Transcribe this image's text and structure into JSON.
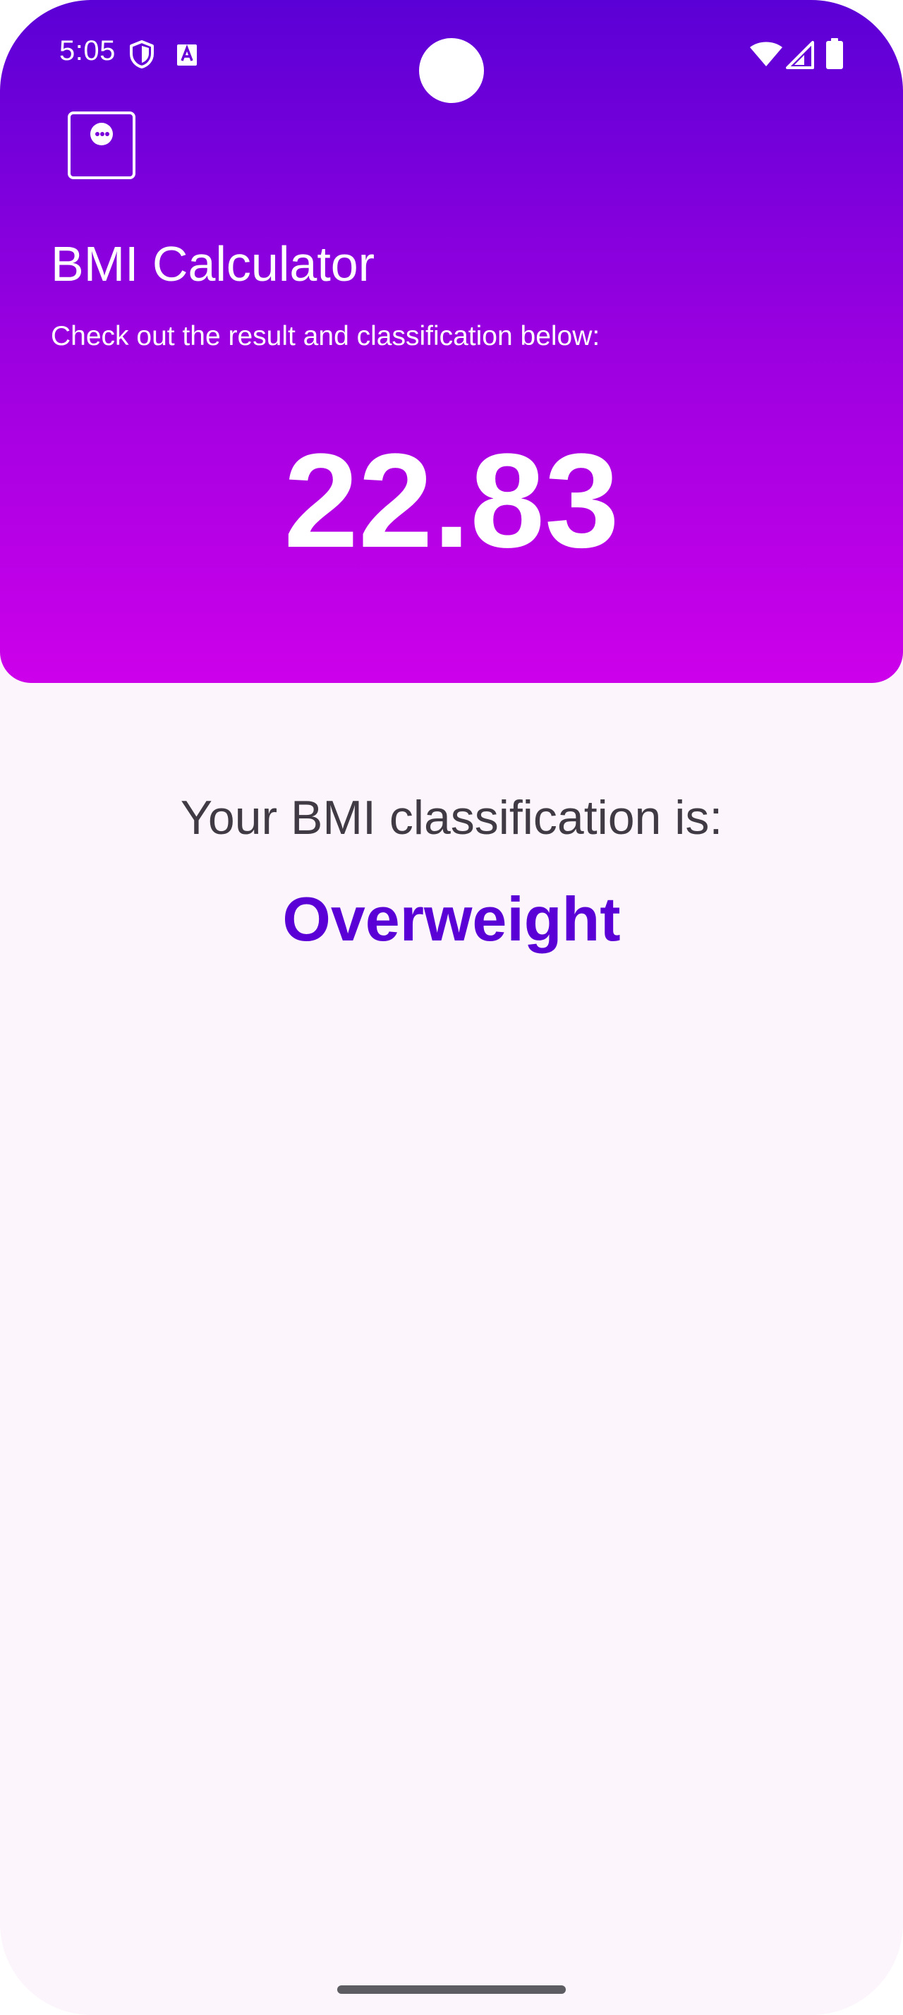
{
  "status_bar": {
    "time": "5:05",
    "left_icons": [
      "shield-icon",
      "font-a-icon"
    ],
    "right_icons": [
      "wifi-icon",
      "cell-signal-icon",
      "battery-icon"
    ]
  },
  "app": {
    "title": "BMI Calculator",
    "subtitle": "Check out the result and classification below:",
    "bmi_value": "22.83",
    "classification_label": "Your BMI classification is:",
    "classification_value": "Overweight"
  },
  "colors": {
    "header_gradient_top": "#5a00d6",
    "header_gradient_bottom": "#cd00ea",
    "accent": "#5a00d6",
    "background": "#fcf5fc",
    "label_text": "#403a44"
  }
}
